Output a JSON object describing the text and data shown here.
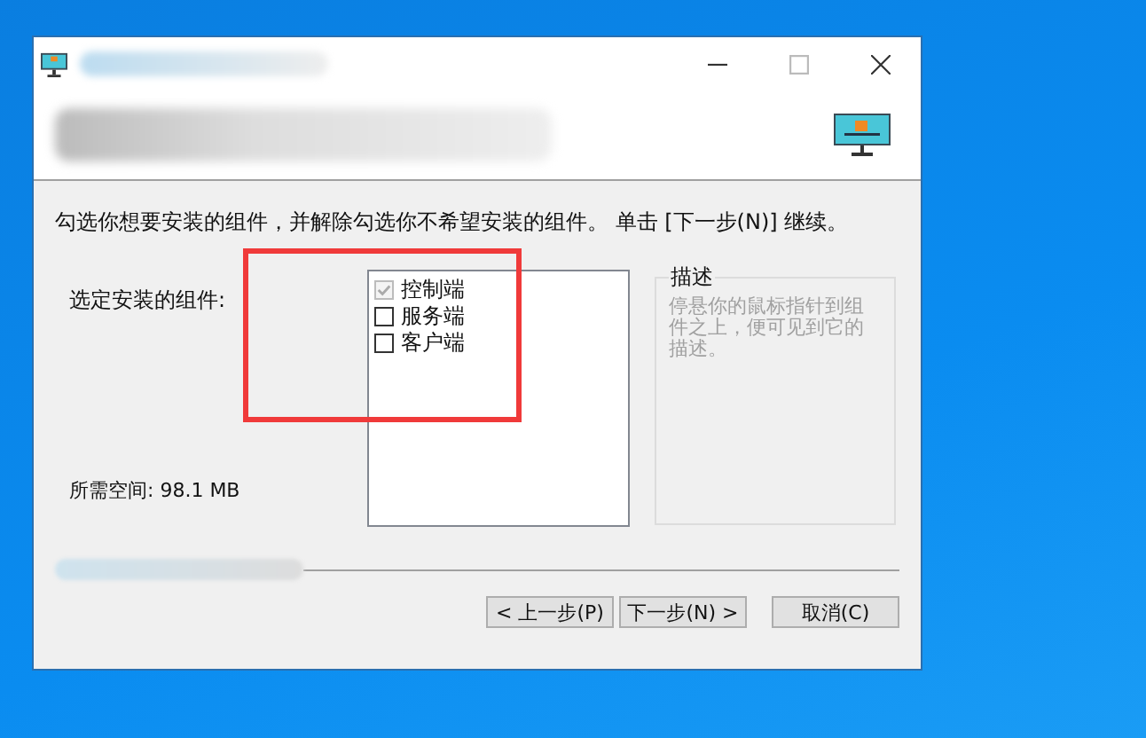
{
  "instruction": "勾选你想要安装的组件，并解除勾选你不希望安装的组件。 单击 [下一步(N)] 继续。",
  "components_label": "选定安装的组件:",
  "components": [
    {
      "label": "控制端",
      "checked": true,
      "disabled": true
    },
    {
      "label": "服务端",
      "checked": false,
      "disabled": false
    },
    {
      "label": "客户端",
      "checked": false,
      "disabled": false
    }
  ],
  "description": {
    "title": "描述",
    "text": "停悬你的鼠标指针到组件之上，便可见到它的描述。"
  },
  "space_required": "所需空间: 98.1 MB",
  "buttons": [
    {
      "label": "< 上一步(P)",
      "kind": "back"
    },
    {
      "label": "下一步(N) >",
      "kind": "next"
    },
    {
      "label": "取消(C)",
      "kind": "cancel"
    }
  ]
}
